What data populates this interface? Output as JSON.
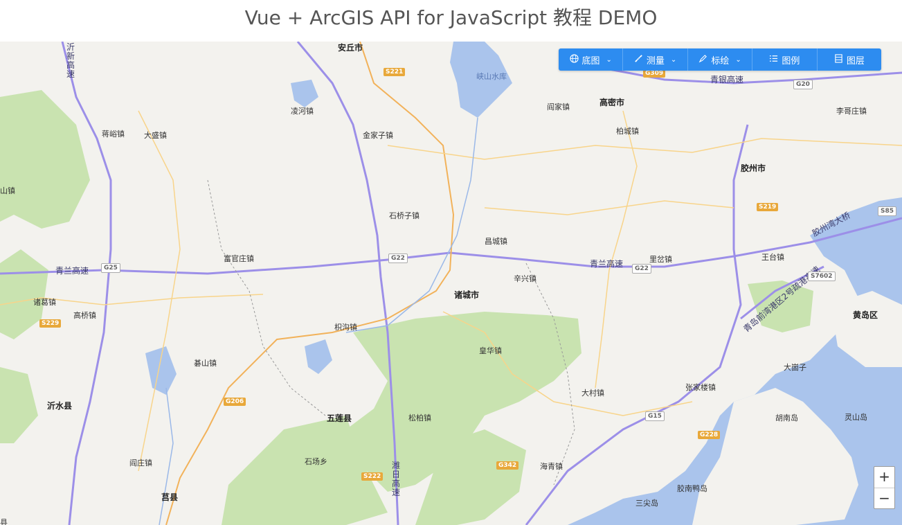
{
  "header": {
    "title": "Vue + ArcGIS API for JavaScript 教程 DEMO"
  },
  "toolbar": {
    "basemap": {
      "label": "底图",
      "icon": "globe-icon"
    },
    "measure": {
      "label": "测量",
      "icon": "ruler-icon"
    },
    "draw": {
      "label": "标绘",
      "icon": "pen-icon"
    },
    "legend": {
      "label": "图例",
      "icon": "list-icon"
    },
    "layers": {
      "label": "图层",
      "icon": "layers-icon"
    },
    "color": "#2d8cf0"
  },
  "zoom": {
    "in": "+",
    "out": "−"
  },
  "map": {
    "places": {
      "anqiu": "安丘市",
      "gaomi": "高密市",
      "jiaozhou": "胶州市",
      "zhucheng": "诸城市",
      "wulian": "五莲县",
      "yishui": "沂水县",
      "juxian": "莒县",
      "huangdao": "黄岛区",
      "lingheng": "凌河镇",
      "jinjiazhuang": "金家子镇",
      "yanjiazhen": "阎家镇",
      "baicheng": "柏城镇",
      "ligezhuang": "李哥庄镇",
      "yuyu": "蒋峪镇",
      "dasheng": "大盛镇",
      "shiqiaozi": "石桥子镇",
      "changcheng": "昌城镇",
      "fuguanzhuang": "富官庄镇",
      "xinxing": "辛兴镇",
      "ligou": "里岔镇",
      "wangtai": "王台镇",
      "zhuge": "诸葛镇",
      "gaoqiao": "高桥镇",
      "jigou": "枳沟镇",
      "huanghua": "皇华镇",
      "qishan": "碁山镇",
      "dacun": "大村镇",
      "zhangjialou": "张家楼镇",
      "dazhuzi": "大崮子",
      "songbai": "松柏镇",
      "shichang": "石场乡",
      "hunan": "胡南岛",
      "lingshan": "灵山岛",
      "yanzhuang": "阎庄镇",
      "haiqing": "海青镇",
      "jiaonan": "胶南鸭岛",
      "sanjiao": "三尖岛",
      "shan": "山镇",
      "ju": "县"
    },
    "water": {
      "xiashan": "峡山水库"
    },
    "roads": {
      "qinglan": "青兰高速",
      "qingyin": "青银高速",
      "jiaozhouwan": "胶州湾大桥",
      "qingdao_port": "青岛前湾港区2号疏港高速",
      "weiri": "潍日高速",
      "yixin": "沂新高速"
    },
    "shields": {
      "s221": "S221",
      "g309": "G309",
      "g20": "G20",
      "s219": "S219",
      "s85": "S85",
      "g22a": "G22",
      "g22b": "G22",
      "g25": "G25",
      "s229": "S229",
      "s7602": "S7602",
      "g206": "G206",
      "g15": "G15",
      "g228": "G228",
      "g342": "G342",
      "s222": "S222"
    }
  }
}
